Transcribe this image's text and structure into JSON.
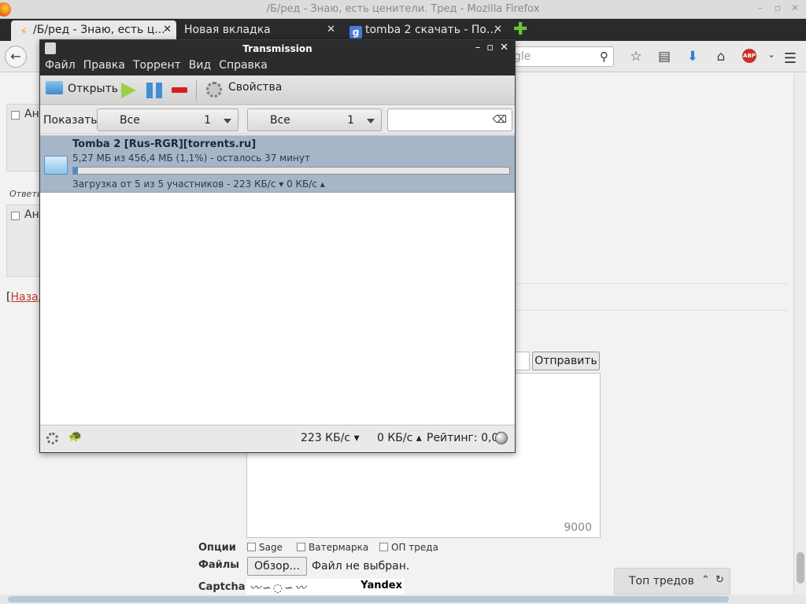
{
  "firefox": {
    "window_title": "/Б/ред - Знаю, есть ценители. Тред - Mozilla Firefox",
    "tabs": [
      {
        "label": "/Б/ред - Знаю, есть ц...",
        "active": true
      },
      {
        "label": "Новая вкладка",
        "active": false
      },
      {
        "label": "tomba 2 скачать - По...",
        "active": false
      }
    ],
    "search_placeholder_partial": "gle"
  },
  "page": {
    "posts": [
      {
        "name_partial": "Ан"
      },
      {
        "name_partial": "Ан"
      }
    ],
    "answers_label": "Ответы",
    "back_link": "Назад",
    "back_bracket": "[",
    "submit_label": "Отправить",
    "char_counter": "9000",
    "options_label": "Опции",
    "options": [
      "Sage",
      "Ватермарка",
      "ОП треда"
    ],
    "files_label": "Файлы",
    "browse_label": "Обзор...",
    "file_status": "Файл не выбран.",
    "captcha_label": "Captcha",
    "captcha_brand": "Yandex",
    "top_threads_label": "Топ тредов"
  },
  "transmission": {
    "title": "Transmission",
    "menu": [
      "Файл",
      "Правка",
      "Торрент",
      "Вид",
      "Справка"
    ],
    "toolbar": {
      "open_label": "Открыть",
      "properties_label": "Свойства"
    },
    "filter": {
      "show_label": "Показать:",
      "status_filter": {
        "value": "Все",
        "count": "1"
      },
      "tracker_filter": {
        "value": "Все",
        "count": "1"
      }
    },
    "torrent": {
      "name": "Tomba 2 [Rus-RGR][torrents.ru]",
      "progress_text": "5,27 МБ из 456,4 МБ (1,1%) - осталось 37 минут",
      "progress_percent": 1.1,
      "status_text": "Загрузка от 5 из 5 участников - 223 КБ/с ▾  0 КБ/с ▴"
    },
    "statusbar": {
      "download_speed": "223 КБ/с ▾",
      "upload_speed": "0 КБ/с ▴",
      "ratio": "Рейтинг: 0,0"
    }
  }
}
